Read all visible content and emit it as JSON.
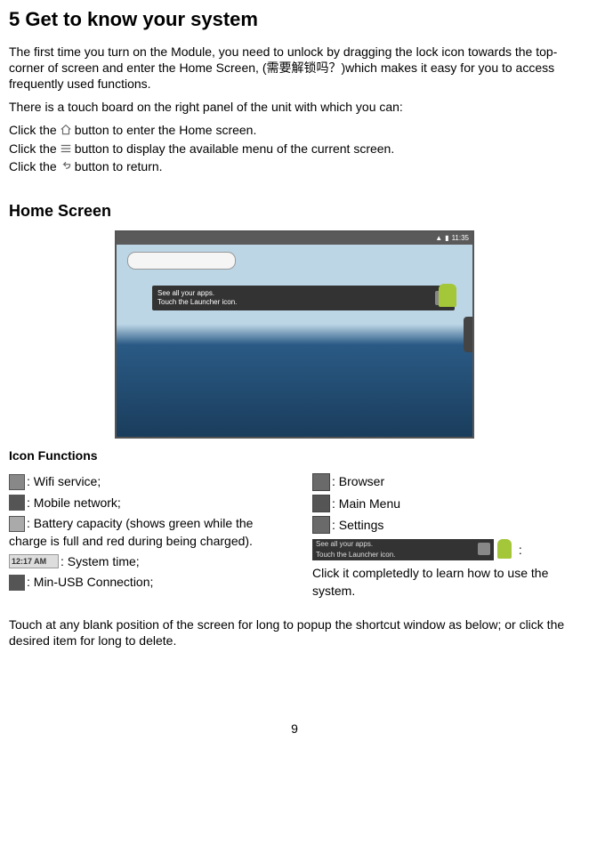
{
  "title": "5 Get to know your system",
  "intro": "The first time you turn on the Module, you need to unlock by dragging the lock icon towards the top-corner of screen and enter the Home Screen, (需要解锁吗？)which makes it easy for you to access frequently used functions.",
  "touchboard_intro": "There is a touch board on the right panel of the unit with which you can:",
  "click_prefix": "Click the ",
  "click_home_suffix": " button to enter the Home screen.",
  "click_menu_suffix": " button to display the available menu of the current screen.",
  "click_return_suffix": " button to return.",
  "home_screen_heading": "Home Screen",
  "status_time": "11:35",
  "tip_line1": "See all your apps.",
  "tip_line2": "Touch the Launcher icon.",
  "icon_functions_heading": "Icon Functions",
  "left": {
    "wifi": ": Wifi service;",
    "mobile": ": Mobile network;",
    "battery": ": Battery capacity (shows green while the charge is full and red during being charged).",
    "time_label": "12:17 AM",
    "time": ": System time;",
    "usb": ": Min-USB Connection;"
  },
  "right": {
    "browser": ": Browser",
    "menu": ": Main Menu",
    "settings": ": Settings",
    "tip_colon": ":",
    "tip_desc": "Click it completedly to learn how to use the system."
  },
  "footer_text": "Touch at any blank position of the screen for long to popup the shortcut window as below; or click the desired item for long to delete.",
  "page_number": "9"
}
